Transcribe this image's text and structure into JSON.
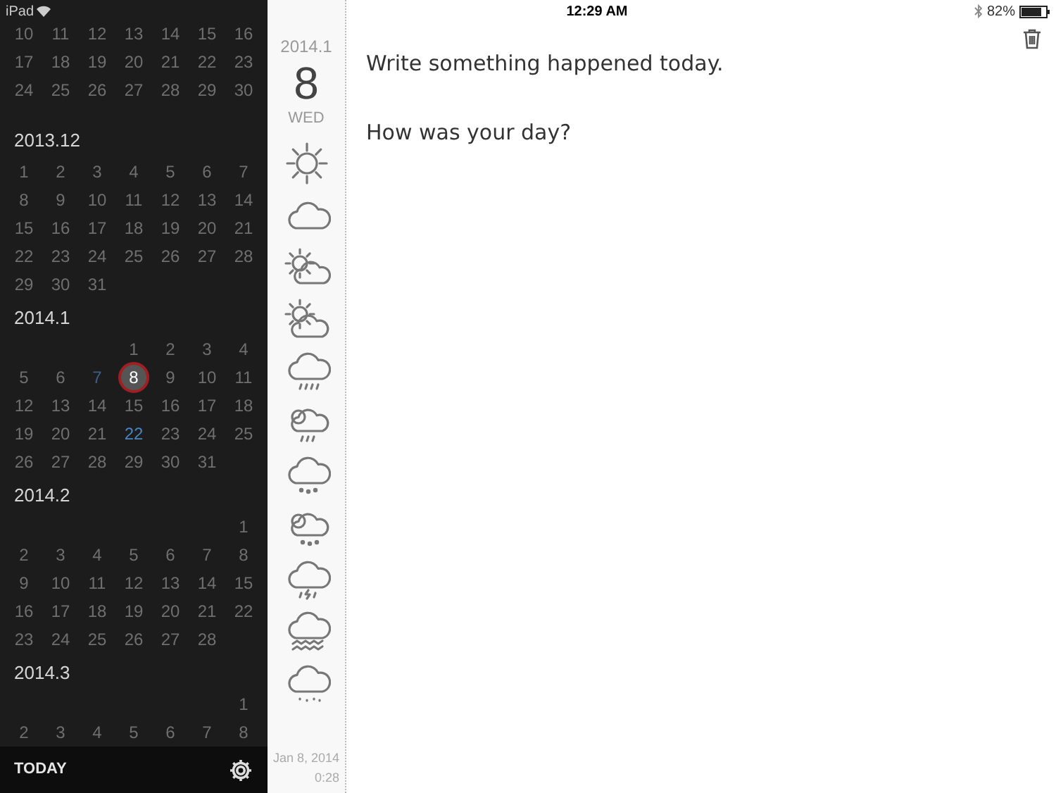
{
  "status_bar": {
    "device": "iPad",
    "time": "12:29 AM",
    "battery": "82%"
  },
  "calendar": {
    "months": [
      {
        "weeks": [
          [
            {
              "day": "10",
              "selected": false
            },
            {
              "day": "11",
              "selected": false
            },
            {
              "day": "12",
              "selected": false
            },
            {
              "day": "13",
              "selected": false
            },
            {
              "day": "14",
              "selected": false
            },
            {
              "day": "15",
              "selected": false
            },
            {
              "day": "16",
              "selected": false
            }
          ],
          [
            {
              "day": "17",
              "selected": false
            },
            {
              "day": "18",
              "selected": false
            },
            {
              "day": "19",
              "selected": false
            },
            {
              "day": "20",
              "selected": false
            },
            {
              "day": "21",
              "selected": false
            },
            {
              "day": "22",
              "selected": false
            },
            {
              "day": "23",
              "selected": false
            }
          ],
          [
            {
              "day": "24",
              "selected": false
            },
            {
              "day": "25",
              "selected": false
            },
            {
              "day": "26",
              "selected": false
            },
            {
              "day": "27",
              "selected": false
            },
            {
              "day": "28",
              "selected": false
            },
            {
              "day": "29",
              "selected": false
            },
            {
              "day": "30",
              "selected": false
            }
          ]
        ]
      },
      {
        "title": "2013.12",
        "weeks": [
          [
            {
              "day": "1",
              "selected": false
            },
            {
              "day": "2",
              "selected": false
            },
            {
              "day": "3",
              "selected": false
            },
            {
              "day": "4",
              "selected": false
            },
            {
              "day": "5",
              "selected": false
            },
            {
              "day": "6",
              "selected": false
            },
            {
              "day": "7",
              "selected": false
            }
          ],
          [
            {
              "day": "8",
              "selected": false
            },
            {
              "day": "9",
              "selected": false
            },
            {
              "day": "10",
              "selected": false
            },
            {
              "day": "11",
              "selected": false
            },
            {
              "day": "12",
              "selected": false
            },
            {
              "day": "13",
              "selected": false
            },
            {
              "day": "14",
              "selected": false
            }
          ],
          [
            {
              "day": "15",
              "selected": false
            },
            {
              "day": "16",
              "selected": false
            },
            {
              "day": "17",
              "selected": false
            },
            {
              "day": "18",
              "selected": false
            },
            {
              "day": "19",
              "selected": false
            },
            {
              "day": "20",
              "selected": false
            },
            {
              "day": "21",
              "selected": false
            }
          ],
          [
            {
              "day": "22",
              "selected": false
            },
            {
              "day": "23",
              "selected": false
            },
            {
              "day": "24",
              "selected": false
            },
            {
              "day": "25",
              "selected": false
            },
            {
              "day": "26",
              "selected": false
            },
            {
              "day": "27",
              "selected": false
            },
            {
              "day": "28",
              "selected": false
            }
          ],
          [
            {
              "day": "29",
              "selected": false
            },
            {
              "day": "30",
              "selected": false
            },
            {
              "day": "31",
              "selected": false
            }
          ]
        ]
      },
      {
        "title": "2014.1",
        "weeks": [
          [
            {
              "day": "1",
              "selected": false
            },
            {
              "day": "2",
              "selected": false
            },
            {
              "day": "3",
              "selected": false
            },
            {
              "day": "4",
              "selected": false
            }
          ],
          [
            {
              "day": "5",
              "selected": false
            },
            {
              "day": "6",
              "selected": false
            },
            {
              "day": "7",
              "selected": false,
              "color": "#3d5f86"
            },
            {
              "day": "8",
              "selected": true
            },
            {
              "day": "9",
              "selected": false
            },
            {
              "day": "10",
              "selected": false
            },
            {
              "day": "11",
              "selected": false
            }
          ],
          [
            {
              "day": "12",
              "selected": false
            },
            {
              "day": "13",
              "selected": false
            },
            {
              "day": "14",
              "selected": false
            },
            {
              "day": "15",
              "selected": false
            },
            {
              "day": "16",
              "selected": false
            },
            {
              "day": "17",
              "selected": false
            },
            {
              "day": "18",
              "selected": false
            }
          ],
          [
            {
              "day": "19",
              "selected": false
            },
            {
              "day": "20",
              "selected": false
            },
            {
              "day": "21",
              "selected": false
            },
            {
              "day": "22",
              "selected": false,
              "color": "#4a84c2"
            },
            {
              "day": "23",
              "selected": false
            },
            {
              "day": "24",
              "selected": false
            },
            {
              "day": "25",
              "selected": false
            }
          ],
          [
            {
              "day": "26",
              "selected": false
            },
            {
              "day": "27",
              "selected": false
            },
            {
              "day": "28",
              "selected": false
            },
            {
              "day": "29",
              "selected": false
            },
            {
              "day": "30",
              "selected": false
            },
            {
              "day": "31",
              "selected": false
            }
          ]
        ]
      },
      {
        "title": "2014.2",
        "weeks": [
          [
            {
              "day": "1",
              "selected": false
            }
          ],
          [
            {
              "day": "2",
              "selected": false
            },
            {
              "day": "3",
              "selected": false
            },
            {
              "day": "4",
              "selected": false
            },
            {
              "day": "5",
              "selected": false
            },
            {
              "day": "6",
              "selected": false
            },
            {
              "day": "7",
              "selected": false
            },
            {
              "day": "8",
              "selected": false
            }
          ],
          [
            {
              "day": "9",
              "selected": false
            },
            {
              "day": "10",
              "selected": false
            },
            {
              "day": "11",
              "selected": false
            },
            {
              "day": "12",
              "selected": false
            },
            {
              "day": "13",
              "selected": false
            },
            {
              "day": "14",
              "selected": false
            },
            {
              "day": "15",
              "selected": false
            }
          ],
          [
            {
              "day": "16",
              "selected": false
            },
            {
              "day": "17",
              "selected": false
            },
            {
              "day": "18",
              "selected": false
            },
            {
              "day": "19",
              "selected": false
            },
            {
              "day": "20",
              "selected": false
            },
            {
              "day": "21",
              "selected": false
            },
            {
              "day": "22",
              "selected": false
            }
          ],
          [
            {
              "day": "23",
              "selected": false
            },
            {
              "day": "24",
              "selected": false
            },
            {
              "day": "25",
              "selected": false
            },
            {
              "day": "26",
              "selected": false
            },
            {
              "day": "27",
              "selected": false
            },
            {
              "day": "28",
              "selected": false
            }
          ]
        ]
      },
      {
        "title": "2014.3",
        "weeks": [
          [
            {
              "day": "1",
              "selected": false
            }
          ],
          [
            {
              "day": "2",
              "selected": false
            },
            {
              "day": "3",
              "selected": false
            },
            {
              "day": "4",
              "selected": false
            },
            {
              "day": "5",
              "selected": false
            },
            {
              "day": "6",
              "selected": false
            },
            {
              "day": "7",
              "selected": false
            },
            {
              "day": "8",
              "selected": false
            }
          ]
        ]
      }
    ]
  },
  "bottom_bar": {
    "today_button": "TODAY"
  },
  "day_column": {
    "month": "2014.1",
    "day": "8",
    "weekday": "WED",
    "timestamp_date": "Jan 8, 2014",
    "timestamp_time": "0:28"
  },
  "entry": {
    "lines": [
      "Write something happened today.",
      "How was your day?"
    ]
  }
}
